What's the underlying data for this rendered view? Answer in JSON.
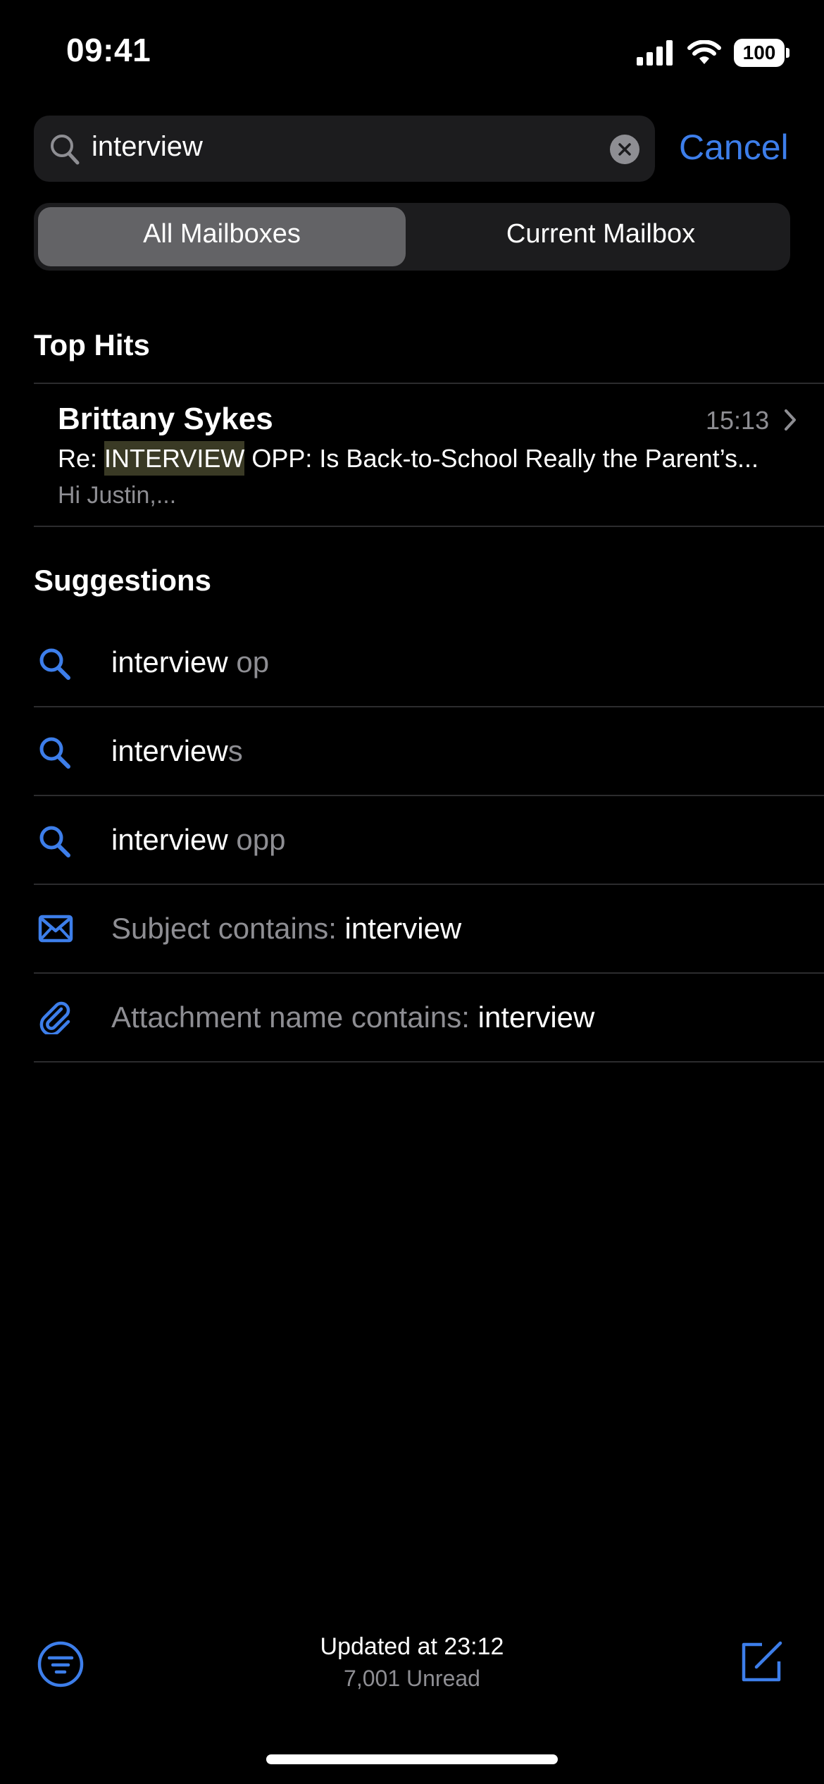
{
  "status_bar": {
    "time": "09:41",
    "battery": "100"
  },
  "search": {
    "query": "interview",
    "cancel_label": "Cancel"
  },
  "scope": {
    "options": [
      "All Mailboxes",
      "Current Mailbox"
    ],
    "selected": "All Mailboxes"
  },
  "top_hits": {
    "header": "Top Hits",
    "items": [
      {
        "sender": "Brittany Sykes",
        "time": "15:13",
        "subject_prefix": "Re: ",
        "subject_highlight": "INTERVIEW",
        "subject_rest": " OPP: Is Back-to-School Really the Parent’s...",
        "preview": "Hi Justin,..."
      }
    ]
  },
  "suggestions": {
    "header": "Suggestions",
    "items": [
      {
        "icon": "search-icon",
        "typed": "interview",
        "completion": " op"
      },
      {
        "icon": "search-icon",
        "typed": "interview",
        "completion": "s"
      },
      {
        "icon": "search-icon",
        "typed": "interview",
        "completion": " opp"
      },
      {
        "icon": "envelope-icon",
        "label": "Subject contains: ",
        "term": "interview"
      },
      {
        "icon": "paperclip-icon",
        "label": "Attachment name contains: ",
        "term": "interview"
      }
    ]
  },
  "toolbar": {
    "updated": "Updated at 23:12",
    "unread": "7,001 Unread"
  },
  "colors": {
    "accent": "#3d7eea",
    "background": "#000000",
    "field": "#1c1c1e",
    "secondary_text": "#8e8e93"
  }
}
